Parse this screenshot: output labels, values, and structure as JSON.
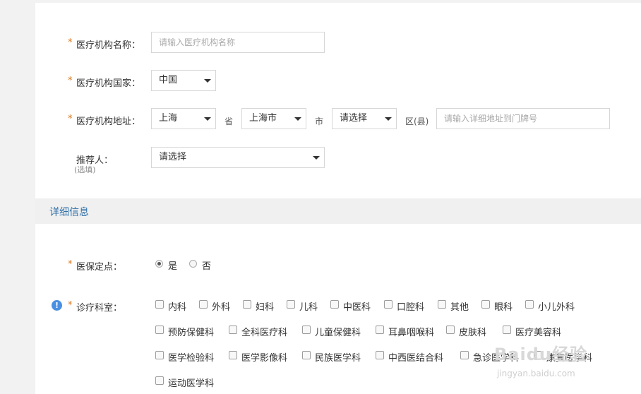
{
  "form": {
    "institution_name": {
      "required": "*",
      "label": "医疗机构名称：",
      "placeholder": "请输入医疗机构名称"
    },
    "institution_country": {
      "required": "*",
      "label": "医疗机构国家：",
      "value": "中国"
    },
    "institution_address": {
      "required": "*",
      "label": "医疗机构地址：",
      "province": "上海",
      "province_unit": "省",
      "city": "上海市",
      "city_unit": "市",
      "district": "请选择",
      "district_unit": "区(县)",
      "detail_placeholder": "请输入详细地址到门牌号"
    },
    "referrer": {
      "label": "推荐人：",
      "optional": "(选填)",
      "value": "请选择"
    }
  },
  "details": {
    "title": "详细信息",
    "insurance": {
      "required": "*",
      "label": "医保定点：",
      "yes": "是",
      "no": "否",
      "selected": "是"
    },
    "departments": {
      "required": "*",
      "label": "诊疗科室：",
      "info_icon": "!",
      "items": [
        "内科",
        "外科",
        "妇科",
        "儿科",
        "中医科",
        "口腔科",
        "其他",
        "眼科",
        "小儿外科",
        "预防保健科",
        "全科医疗科",
        "儿童保健科",
        "耳鼻咽喉科",
        "皮肤科",
        "医疗美容科",
        "医学检验科",
        "医学影像科",
        "民族医学科",
        "中西医结合科",
        "急诊医学科",
        "康复医学科",
        "运动医学科"
      ]
    }
  },
  "watermark": {
    "brand": "Baidu经验",
    "url": "jingyan.baidu.com"
  }
}
